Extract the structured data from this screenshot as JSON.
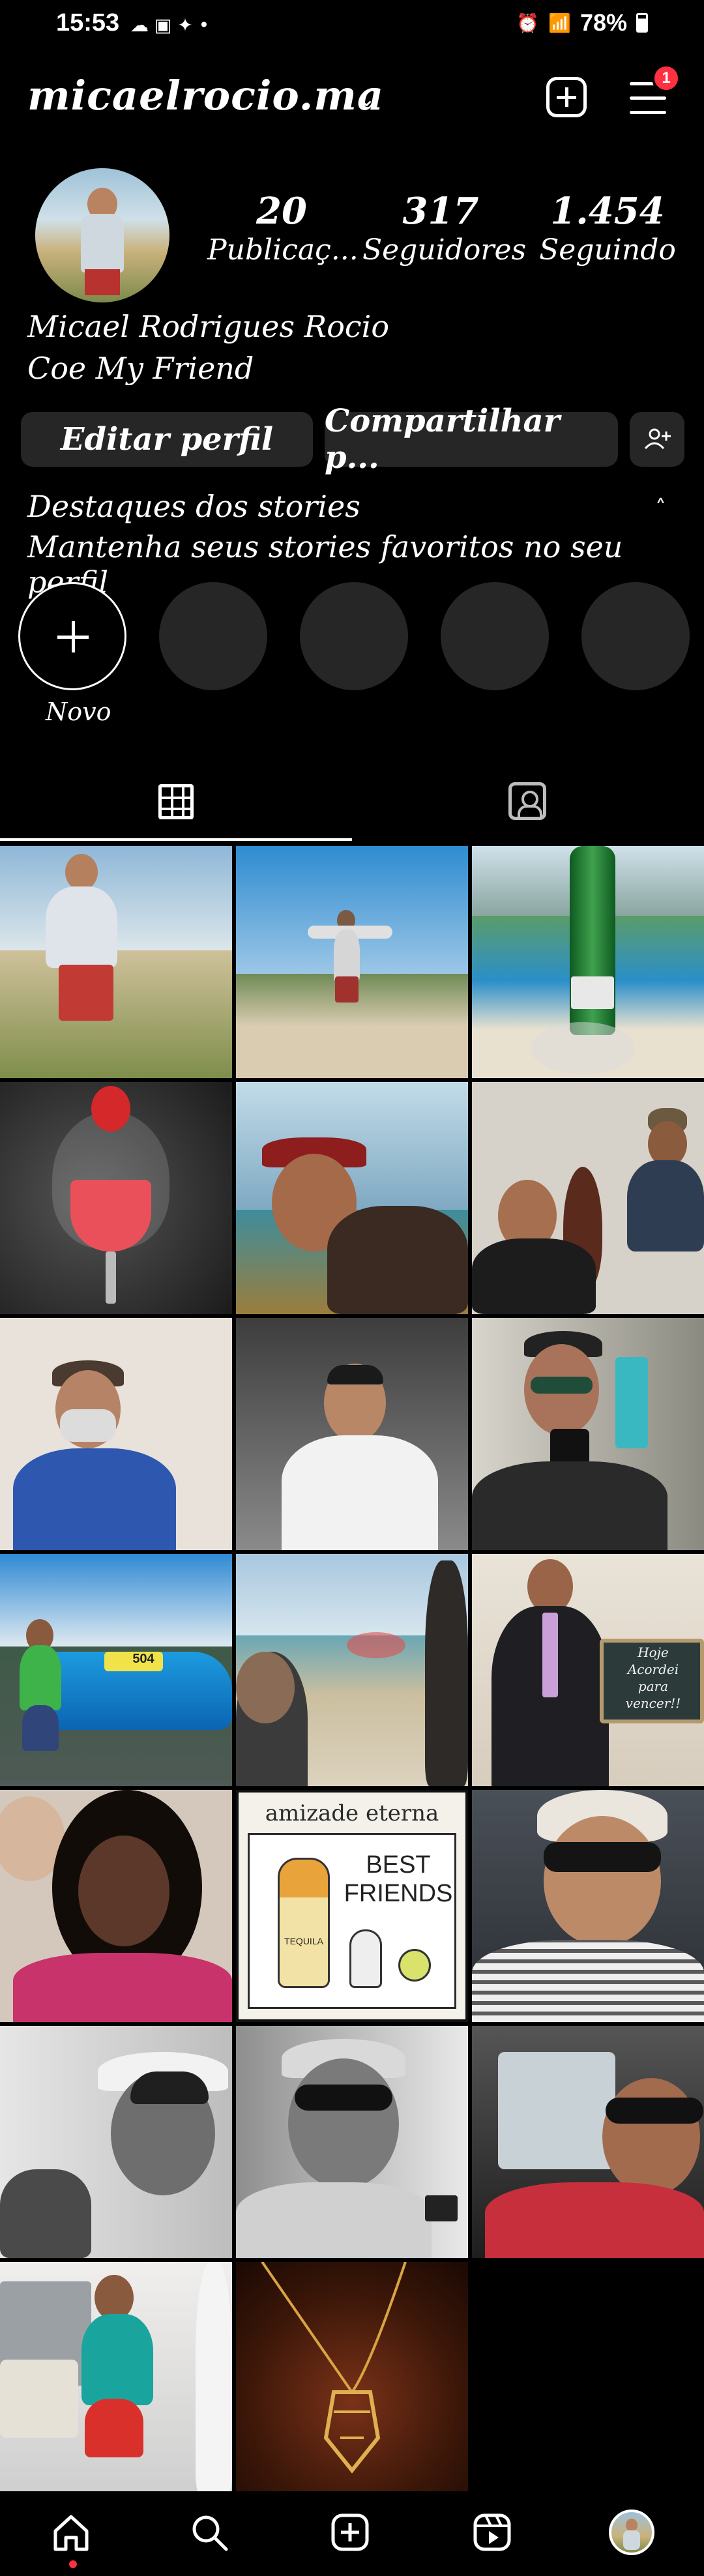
{
  "status_bar": {
    "time": "15:53",
    "left_icons": [
      "cloud-icon",
      "message-icon",
      "twitter-icon",
      "dot-icon"
    ],
    "battery": "78%"
  },
  "header": {
    "username": "micaelrocio.ma",
    "notification_count": "1"
  },
  "profile": {
    "stats": [
      {
        "value": "20",
        "label": "Publicaç..."
      },
      {
        "value": "317",
        "label": "Seguidores"
      },
      {
        "value": "1.454",
        "label": "Seguindo"
      }
    ],
    "full_name": "Micael Rodrigues Rocio",
    "bio": "Coe My Friend"
  },
  "actions": {
    "edit_label": "Editar perfil",
    "share_label": "Compartilhar p..."
  },
  "highlights": {
    "title": "Destaques dos stories",
    "subtitle": "Mantenha seus stories favoritos no seu perfil",
    "new_label": "Novo"
  },
  "posts": {
    "text_post_title": "amizade eterna",
    "text_post_line1": "BEST",
    "text_post_line2": "FRIENDS",
    "text_post_bottle": "TEQUILA",
    "sign_text_1": "Hoje",
    "sign_text_2": "Acordei",
    "sign_text_3": "para",
    "sign_text_4": "vencer!!",
    "car_plate": "504"
  },
  "colors": {
    "background": "#000000",
    "button_bg": "#262626",
    "badge": "#ff3040"
  }
}
